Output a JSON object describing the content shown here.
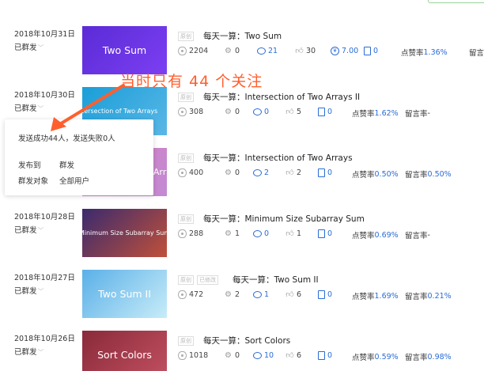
{
  "annotation": "当时只有 44 个关注",
  "popup": {
    "result": "发送成功44人，发送失败0人",
    "publish_to_label": "发布到",
    "publish_to_value": "群发",
    "target_label": "群发对象",
    "target_value": "全部用户"
  },
  "labels": {
    "like_rate": "点赞率",
    "comment_rate": "留言率"
  },
  "articles": [
    {
      "date": "2018年10月31日",
      "status": "已群发",
      "thumb_text": "Two Sum",
      "badges": [
        "原创"
      ],
      "title": "每天一算：Two Sum",
      "reads": "2204",
      "shares": "0",
      "comments": "21",
      "likes": "30",
      "rewards": "7.00",
      "forwards": "0",
      "like_rate": "1.36%",
      "comment_rate": "",
      "colors": [
        "#5b2bd6",
        "#7b3ff2"
      ]
    },
    {
      "date": "2018年10月30日",
      "status": "已群发",
      "thumb_text": "Intersection of Two Arrays",
      "badges": [
        "原创"
      ],
      "title": "每天一算：Intersection of Two Arrays II",
      "reads": "308",
      "shares": "0",
      "comments": "0",
      "likes": "5",
      "forwards": "0",
      "like_rate": "1.62%",
      "comment_rate": "-",
      "colors": [
        "#1a9ed8",
        "#5ab7e6"
      ]
    },
    {
      "date": "",
      "status": "",
      "thumb_text": "Arra",
      "badges": [
        "原创"
      ],
      "title": "每天一算：Intersection of Two Arrays",
      "reads": "400",
      "shares": "0",
      "comments": "2",
      "likes": "2",
      "forwards": "0",
      "like_rate": "0.50%",
      "comment_rate": "0.50%",
      "colors": [
        "#d47fc0",
        "#c38ad3"
      ]
    },
    {
      "date": "2018年10月28日",
      "status": "已群发",
      "thumb_text": "Minimum Size Subarray Sum",
      "badges": [
        "原创"
      ],
      "title": "每天一算：Minimum Size Subarray Sum",
      "reads": "288",
      "shares": "1",
      "comments": "0",
      "likes": "1",
      "forwards": "0",
      "like_rate": "0.69%",
      "comment_rate": "-",
      "colors": [
        "#3a2a6e",
        "#c0503a"
      ]
    },
    {
      "date": "2018年10月27日",
      "status": "已群发",
      "thumb_text": "Two Sum II",
      "badges": [
        "原创",
        "已修改"
      ],
      "title": "每天一算：Two Sum II",
      "reads": "472",
      "shares": "2",
      "comments": "1",
      "likes": "6",
      "forwards": "0",
      "like_rate": "1.69%",
      "comment_rate": "0.21%",
      "colors": [
        "#5ab0e8",
        "#c8ecf8"
      ]
    },
    {
      "date": "2018年10月26日",
      "status": "已群发",
      "thumb_text": "Sort Colors",
      "badges": [
        "原创"
      ],
      "title": "每天一算：Sort Colors",
      "reads": "1018",
      "shares": "0",
      "comments": "10",
      "likes": "6",
      "forwards": "0",
      "like_rate": "0.59%",
      "comment_rate": "0.98%",
      "colors": [
        "#8a2a3a",
        "#c05060"
      ]
    }
  ]
}
